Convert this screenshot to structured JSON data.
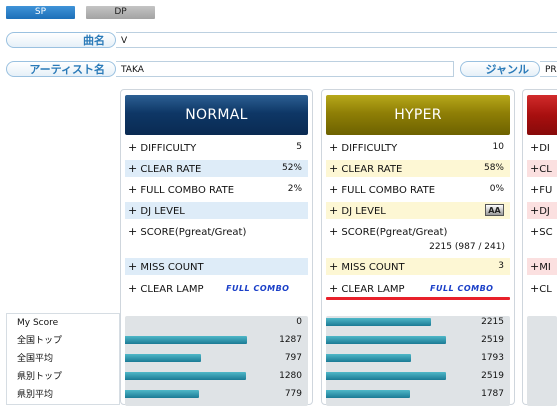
{
  "tabs": [
    {
      "label": "SP"
    },
    {
      "label": "DP"
    }
  ],
  "info": {
    "title_label": "曲名",
    "title_value": "V",
    "artist_label": "アーティスト名",
    "artist_value": "TAKA",
    "genre_label": "ジャンル",
    "genre_value": "PR"
  },
  "score_list": [
    "My Score",
    "全国トップ",
    "全国平均",
    "県別トップ",
    "県別平均"
  ],
  "normal": {
    "title": "NORMAL",
    "rows": [
      {
        "label": "DIFFICULTY",
        "value": "5"
      },
      {
        "label": "CLEAR RATE",
        "value": "52%"
      },
      {
        "label": "FULL COMBO RATE",
        "value": "2%"
      },
      {
        "label": "DJ LEVEL",
        "value": ""
      },
      {
        "label": "SCORE(Pgreat/Great)",
        "value": ""
      },
      {
        "label": "MISS COUNT",
        "value": ""
      },
      {
        "label": "CLEAR LAMP",
        "value": "FULL COMBO"
      }
    ],
    "score_detail": "",
    "miss_value": "",
    "bars": [
      {
        "value": "0",
        "fraction": 0.0
      },
      {
        "value": "1287",
        "fraction": 1.0
      },
      {
        "value": "797",
        "fraction": 0.62
      },
      {
        "value": "1280",
        "fraction": 0.99
      },
      {
        "value": "779",
        "fraction": 0.61
      }
    ]
  },
  "hyper": {
    "title": "HYPER",
    "rows": [
      {
        "label": "DIFFICULTY",
        "value": "10"
      },
      {
        "label": "CLEAR RATE",
        "value": "58%"
      },
      {
        "label": "FULL COMBO RATE",
        "value": "0%"
      },
      {
        "label": "DJ LEVEL",
        "value": "AA"
      },
      {
        "label": "SCORE(Pgreat/Great)",
        "value": ""
      },
      {
        "label": "MISS COUNT",
        "value": "3"
      },
      {
        "label": "CLEAR LAMP",
        "value": "FULL COMBO"
      }
    ],
    "score_detail": "2215 (987 / 241)",
    "bars": [
      {
        "value": "2215",
        "fraction": 0.86
      },
      {
        "value": "2519",
        "fraction": 0.98
      },
      {
        "value": "1793",
        "fraction": 0.7
      },
      {
        "value": "2519",
        "fraction": 0.98
      },
      {
        "value": "1787",
        "fraction": 0.69
      }
    ]
  },
  "another": {
    "title": "",
    "row_labels": [
      "DI",
      "CL",
      "FU",
      "DJ",
      "SC",
      "MI",
      "CL"
    ]
  },
  "colors": {
    "normal_head": "#0e3766",
    "hyper_head": "#8f7f06",
    "another_head": "#a80f0f",
    "bar": "#1b7a95",
    "clear_lamp_line": "#e8202a"
  }
}
